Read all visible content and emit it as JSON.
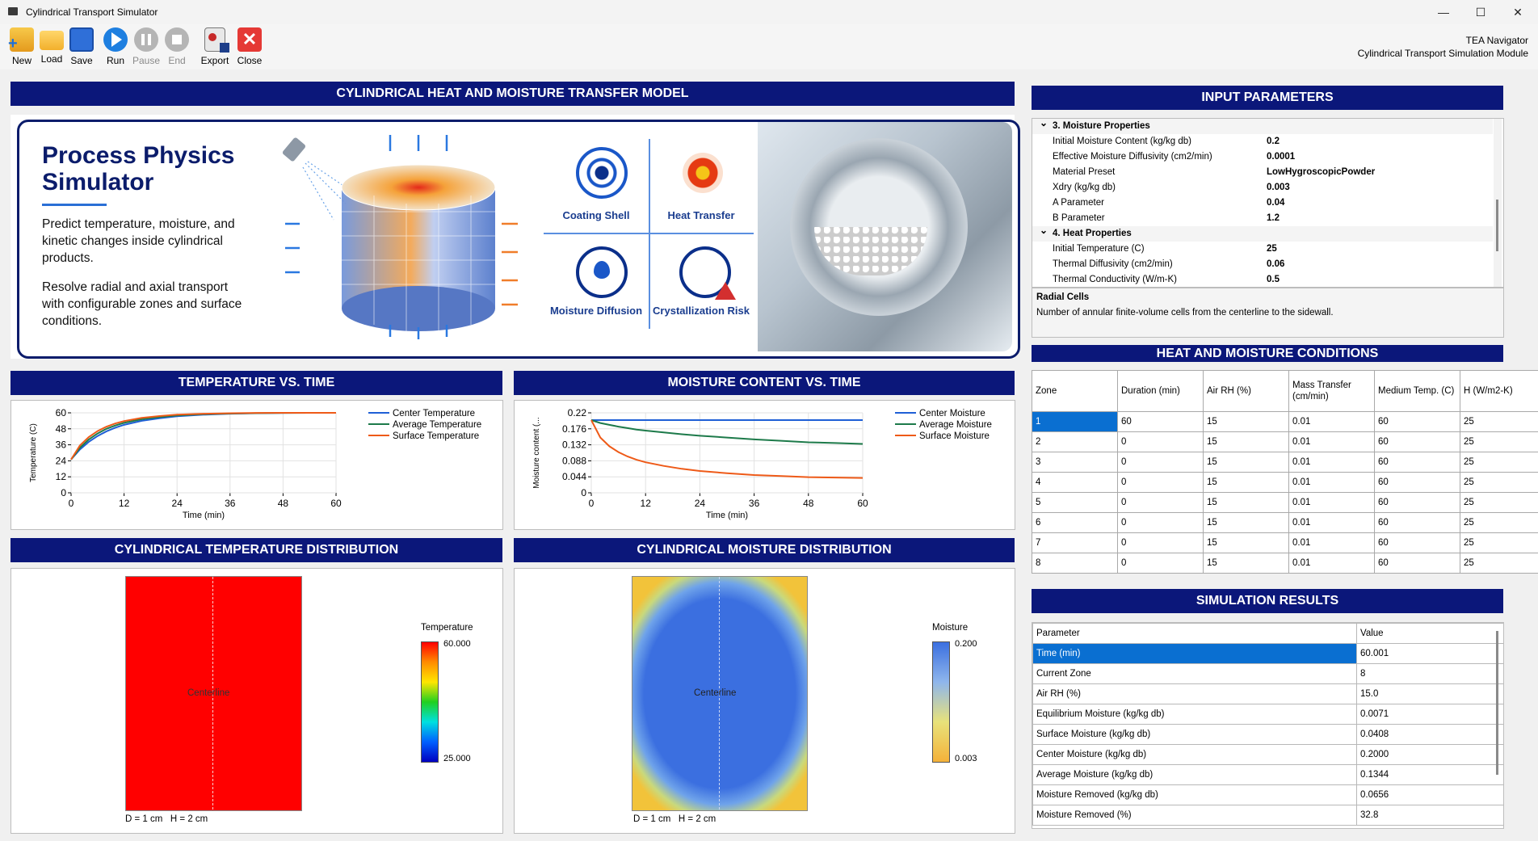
{
  "window": {
    "title": "Cylindrical Transport Simulator"
  },
  "toolbar": {
    "new": "New",
    "load": "Load",
    "save": "Save",
    "run": "Run",
    "pause": "Pause",
    "end": "End",
    "export": "Export",
    "close": "Close"
  },
  "navigator": {
    "title": "TEA Navigator",
    "subtitle": "Cylindrical Transport Simulation Module"
  },
  "model": {
    "header": "CYLINDRICAL HEAT AND MOISTURE TRANSFER MODEL",
    "banner_title_1": "Process Physics",
    "banner_title_2": "Simulator",
    "banner_text_1": "Predict temperature, moisture, and kinetic changes inside cylindrical products.",
    "banner_text_2": "Resolve radial and axial transport with configurable zones and surface conditions.",
    "features": [
      "Coating Shell",
      "Heat Transfer",
      "Moisture Diffusion",
      "Crystallization Risk"
    ]
  },
  "charts": {
    "temperature": {
      "header": "TEMPERATURE VS. TIME",
      "chart_data": {
        "type": "line",
        "xlabel": "Time (min)",
        "ylabel": "Temperature (C)",
        "xlim": [
          0,
          60
        ],
        "ylim": [
          0,
          60
        ],
        "xticks": [
          "0",
          "12",
          "24",
          "36",
          "48",
          "60"
        ],
        "yticks": [
          "0",
          "12",
          "24",
          "36",
          "48",
          "60"
        ],
        "x": [
          0,
          2,
          4,
          6,
          8,
          10,
          12,
          16,
          20,
          24,
          30,
          36,
          42,
          48,
          54,
          60
        ],
        "series": [
          {
            "name": "Center Temperature",
            "color": "#1f5fd6",
            "values": [
              25,
              32.5,
              38.2,
              42.6,
              46.1,
              48.8,
              51.0,
              54.0,
              55.9,
              57.4,
              58.6,
              59.3,
              59.7,
              59.9,
              60.0,
              60.0
            ]
          },
          {
            "name": "Average Temperature",
            "color": "#1d7a4a",
            "values": [
              25,
              33.8,
              40.0,
              44.5,
              48.0,
              50.5,
              52.5,
              55.2,
              56.8,
              58.0,
              59.0,
              59.5,
              59.8,
              59.9,
              60.0,
              60.0
            ]
          },
          {
            "name": "Surface Temperature",
            "color": "#ee5a18",
            "values": [
              25,
              35.5,
              41.8,
              46.3,
              49.6,
              52.0,
              53.8,
              56.2,
              57.6,
              58.6,
              59.3,
              59.7,
              59.9,
              60.0,
              60.0,
              60.0
            ]
          }
        ]
      }
    },
    "moisture": {
      "header": "MOISTURE CONTENT VS. TIME",
      "chart_data": {
        "type": "line",
        "xlabel": "Time (min)",
        "ylabel": "Moisture content (...",
        "xlim": [
          0,
          60
        ],
        "ylim": [
          0,
          0.22
        ],
        "xticks": [
          "0",
          "12",
          "24",
          "36",
          "48",
          "60"
        ],
        "yticks": [
          "0",
          "0.044",
          "0.088",
          "0.132",
          "0.176",
          "0.22"
        ],
        "x": [
          0,
          2,
          4,
          6,
          8,
          10,
          12,
          16,
          20,
          24,
          30,
          36,
          42,
          48,
          54,
          60
        ],
        "series": [
          {
            "name": "Center Moisture",
            "color": "#1f5fd6",
            "values": [
              0.2,
              0.2,
              0.2,
              0.2,
              0.2,
              0.2,
              0.2,
              0.2,
              0.2,
              0.2,
              0.2,
              0.2,
              0.2,
              0.2,
              0.2,
              0.2
            ]
          },
          {
            "name": "Average Moisture",
            "color": "#1d7a4a",
            "values": [
              0.2,
              0.192,
              0.187,
              0.182,
              0.178,
              0.174,
              0.171,
              0.166,
              0.161,
              0.157,
              0.152,
              0.147,
              0.143,
              0.139,
              0.137,
              0.1344
            ]
          },
          {
            "name": "Surface Moisture",
            "color": "#ee5a18",
            "values": [
              0.2,
              0.152,
              0.128,
              0.112,
              0.1,
              0.091,
              0.084,
              0.074,
              0.066,
              0.06,
              0.054,
              0.049,
              0.046,
              0.043,
              0.042,
              0.0408
            ]
          }
        ]
      }
    }
  },
  "distributions": {
    "temperature": {
      "header": "CYLINDRICAL TEMPERATURE DISTRIBUTION",
      "centerline": "Centerline",
      "dims": "D = 1 cm   H = 2 cm",
      "legend_title": "Temperature",
      "legend_max": "60.000",
      "legend_min": "25.000",
      "fill_color": "#ff0000"
    },
    "moisture": {
      "header": "CYLINDRICAL MOISTURE DISTRIBUTION",
      "centerline": "Centerline",
      "dims": "D = 1 cm   H = 2 cm",
      "legend_title": "Moisture",
      "legend_max": "0.200",
      "legend_min": "0.003",
      "fill_color": "#3b6fe0"
    }
  },
  "inputs": {
    "header": "INPUT PARAMETERS",
    "rows": [
      {
        "type": "cat",
        "label": "3. Moisture Properties"
      },
      {
        "type": "prop",
        "label": "Initial Moisture Content (kg/kg db)",
        "value": "0.2"
      },
      {
        "type": "prop",
        "label": "Effective Moisture Diffusivity (cm2/min)",
        "value": "0.0001"
      },
      {
        "type": "prop",
        "label": "Material Preset",
        "value": "LowHygroscopicPowder"
      },
      {
        "type": "prop",
        "label": "Xdry (kg/kg db)",
        "value": "0.003"
      },
      {
        "type": "prop",
        "label": "A Parameter",
        "value": "0.04"
      },
      {
        "type": "prop",
        "label": "B Parameter",
        "value": "1.2"
      },
      {
        "type": "cat",
        "label": "4. Heat Properties"
      },
      {
        "type": "prop",
        "label": "Initial Temperature (C)",
        "value": "25"
      },
      {
        "type": "prop",
        "label": "Thermal Diffusivity (cm2/min)",
        "value": "0.06"
      },
      {
        "type": "prop",
        "label": "Thermal Conductivity (W/m-K)",
        "value": "0.5"
      }
    ],
    "help_title": "Radial Cells",
    "help_text": "Number of annular finite-volume cells from the centerline to the sidewall."
  },
  "conditions": {
    "header": "HEAT AND MOISTURE CONDITIONS",
    "columns": [
      "Zone",
      "Duration (min)",
      "Air RH (%)",
      "Mass Transfer (cm/min)",
      "Medium Temp. (C)",
      "H (W/m2-K)"
    ],
    "rows": [
      [
        "1",
        "60",
        "15",
        "0.01",
        "60",
        "25"
      ],
      [
        "2",
        "0",
        "15",
        "0.01",
        "60",
        "25"
      ],
      [
        "3",
        "0",
        "15",
        "0.01",
        "60",
        "25"
      ],
      [
        "4",
        "0",
        "15",
        "0.01",
        "60",
        "25"
      ],
      [
        "5",
        "0",
        "15",
        "0.01",
        "60",
        "25"
      ],
      [
        "6",
        "0",
        "15",
        "0.01",
        "60",
        "25"
      ],
      [
        "7",
        "0",
        "15",
        "0.01",
        "60",
        "25"
      ],
      [
        "8",
        "0",
        "15",
        "0.01",
        "60",
        "25"
      ]
    ]
  },
  "results": {
    "header": "SIMULATION RESULTS",
    "columns": [
      "Parameter",
      "Value"
    ],
    "rows": [
      [
        "Time (min)",
        "60.001"
      ],
      [
        "Current Zone",
        "8"
      ],
      [
        "Air RH (%)",
        "15.0"
      ],
      [
        "Equilibrium Moisture (kg/kg db)",
        "0.0071"
      ],
      [
        "Surface Moisture (kg/kg db)",
        "0.0408"
      ],
      [
        "Center Moisture (kg/kg db)",
        "0.2000"
      ],
      [
        "Average Moisture (kg/kg db)",
        "0.1344"
      ],
      [
        "Moisture Removed (kg/kg db)",
        "0.0656"
      ],
      [
        "Moisture Removed (%)",
        "32.8"
      ]
    ]
  }
}
